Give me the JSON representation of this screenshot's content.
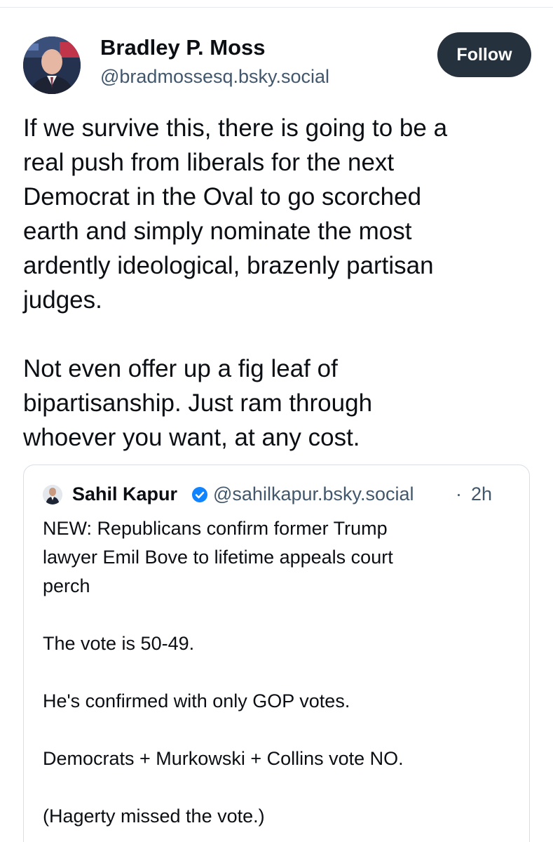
{
  "post": {
    "author": {
      "name": "Bradley P. Moss",
      "handle": "@bradmossesq.bsky.social",
      "avatar_icon": "person-photo-icon"
    },
    "follow_label": "Follow",
    "paragraphs": [
      [
        "If we survive this, there is going to be a",
        "real push from liberals for the next",
        "Democrat in the Oval to go scorched",
        "earth and simply nominate the most",
        "ardently ideological, brazenly partisan",
        "judges."
      ],
      [
        "Not even offer up a fig leaf of",
        "bipartisanship. Just ram through",
        "whoever you want, at any cost."
      ]
    ]
  },
  "quote": {
    "author": {
      "name": "Sahil Kapur",
      "handle": "@sahilkapur.bsky.social",
      "separator": "·",
      "time": "2h",
      "verified_icon": "verified-badge-icon",
      "verified_color": "#1083fe"
    },
    "lines": [
      "NEW: Republicans confirm former Trump",
      "lawyer Emil Bove to lifetime appeals court",
      "perch",
      "",
      "The vote is 50-49.",
      "",
      "He's confirmed with only GOP votes.",
      "",
      "Democrats + Murkowski + Collins vote NO.",
      "",
      "(Hagerty missed the vote.)"
    ]
  },
  "colors": {
    "follow_bg": "#25313c",
    "handle_text": "#42576c",
    "card_border": "#d9dfe5"
  }
}
